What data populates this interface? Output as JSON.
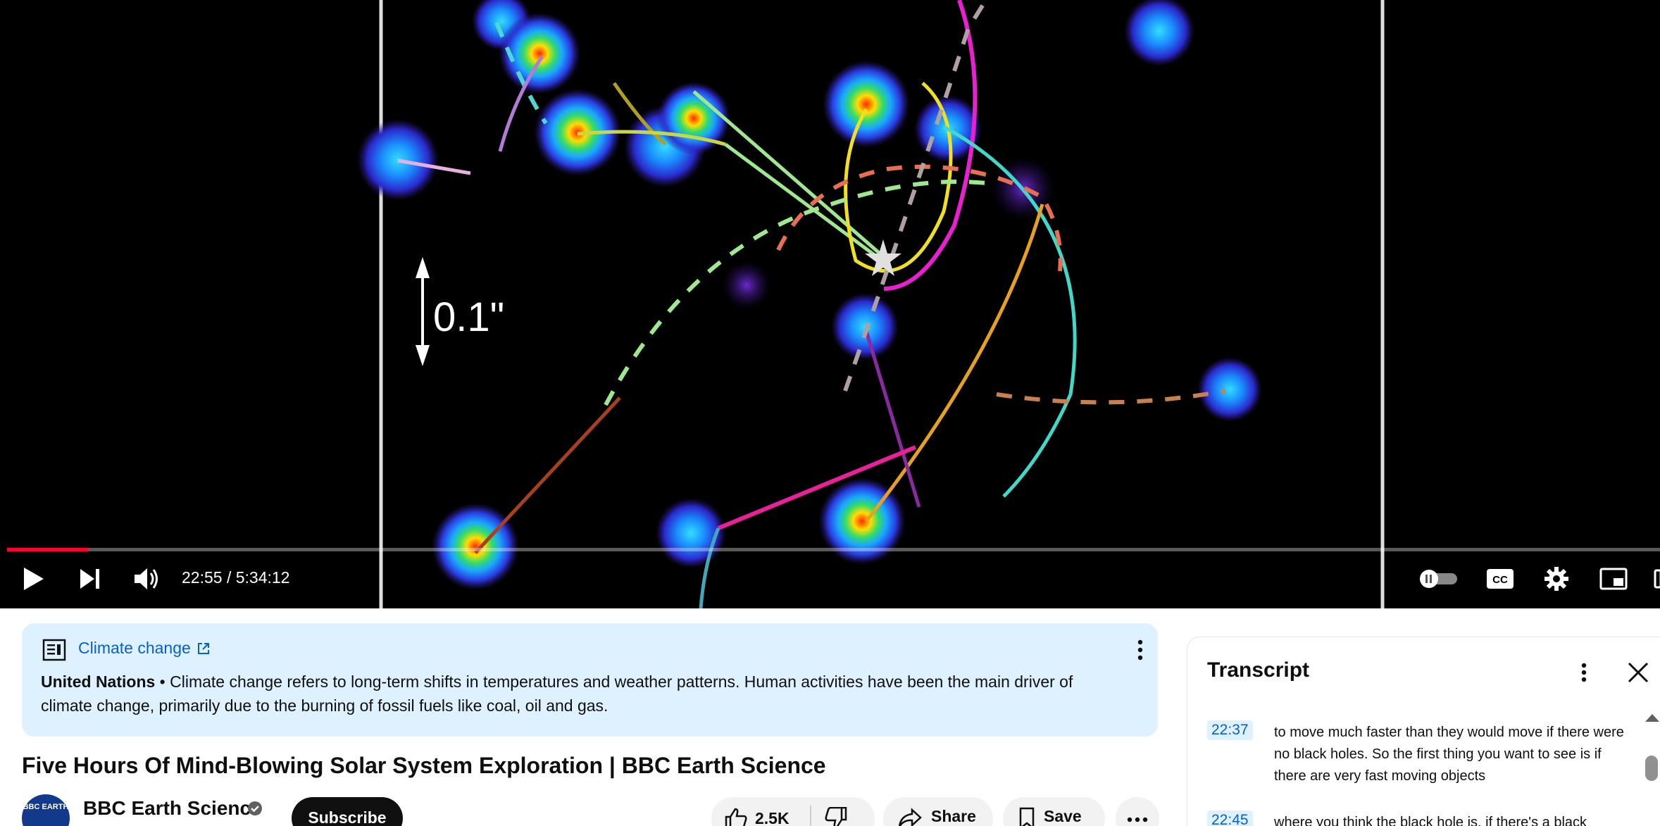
{
  "player": {
    "scale_label": "0.1\"",
    "current_time": "22:55",
    "separator": " / ",
    "duration": "5:34:12",
    "progress_fraction": 0.049
  },
  "info_panel": {
    "link_text": "Climate change",
    "source": "United Nations",
    "description": " • Climate change refers to long-term shifts in temperatures and weather patterns. Human activities have been the main driver of climate change, primarily due to the burning of fossil fuels like coal, oil and gas."
  },
  "video": {
    "title": "Five Hours Of Mind-Blowing Solar System Exploration | BBC Earth Science"
  },
  "channel": {
    "name": "BBC Earth Science",
    "avatar_text": "BBC EARTH",
    "subscribe_label": "Subscribe"
  },
  "actions": {
    "like_count": "2.5K",
    "share_label": "Share",
    "save_label": "Save"
  },
  "transcript": {
    "title": "Transcript",
    "segments": [
      {
        "time": "22:37",
        "text": "to move much faster than they would move if there were no black holes. So the first thing you want to see is if there are very fast moving objects"
      },
      {
        "time": "22:45",
        "text": "where you think the black hole is, if there's a black"
      }
    ]
  },
  "colors": {
    "accent_red": "#ff0033",
    "link_blue": "#065fd4",
    "info_bg": "#def1ff"
  }
}
